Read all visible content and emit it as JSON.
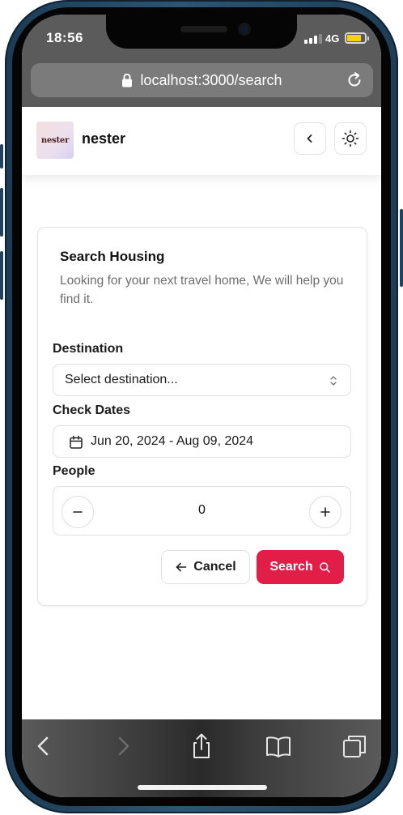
{
  "status": {
    "time": "18:56",
    "network": "4G"
  },
  "browser": {
    "url": "localhost:3000/search"
  },
  "header": {
    "logo_text": "nester",
    "brand": "nester"
  },
  "search_card": {
    "title": "Search Housing",
    "description": "Looking for your next travel home, We will help you find it.",
    "destination_label": "Destination",
    "destination_placeholder": "Select destination...",
    "dates_label": "Check Dates",
    "dates_value": "Jun 20, 2024 - Aug 09, 2024",
    "people_label": "People",
    "people_count": "0",
    "cancel_label": "Cancel",
    "search_label": "Search"
  },
  "colors": {
    "accent": "#e11d48",
    "toolbar": "#3a3a3a"
  },
  "icons": [
    "lock-icon",
    "reload-icon",
    "chevron-left-icon",
    "sun-icon",
    "up-down-chevron-icon",
    "calendar-icon",
    "minus-icon",
    "plus-icon",
    "arrow-left-icon",
    "search-icon",
    "back-icon",
    "forward-icon",
    "share-icon",
    "bookmarks-icon",
    "tabs-icon"
  ]
}
